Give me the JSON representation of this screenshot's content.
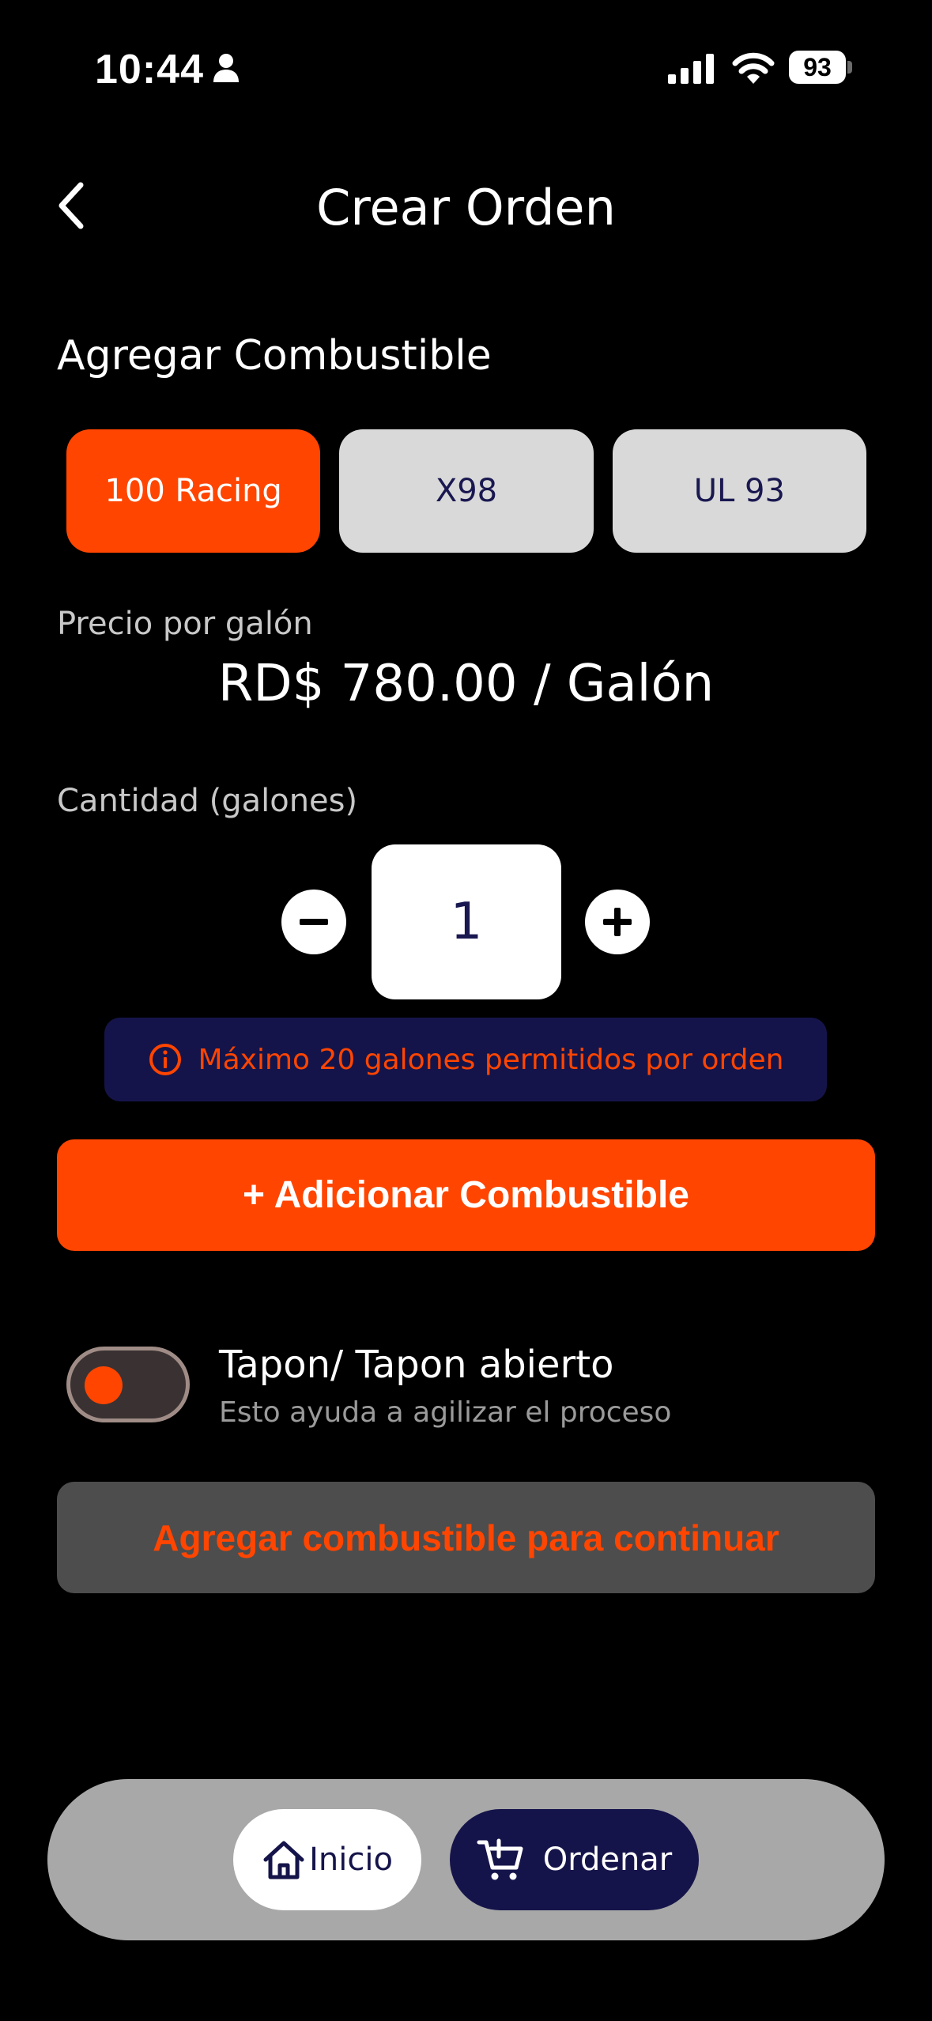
{
  "status_bar": {
    "time": "10:44",
    "battery": "93",
    "icons": [
      "person-icon",
      "signal-icon",
      "wifi-icon",
      "battery-icon"
    ]
  },
  "header": {
    "title": "Crear Orden",
    "back_icon": "chevron-left-icon"
  },
  "fuel": {
    "section_title": "Agregar Combustible",
    "options": [
      {
        "label": "100 Racing",
        "selected": true
      },
      {
        "label": "X98",
        "selected": false
      },
      {
        "label": "UL 93",
        "selected": false
      }
    ]
  },
  "price": {
    "label": "Precio por galón",
    "value": "RD$ 780.00 / Galón"
  },
  "quantity": {
    "label": "Cantidad (galones)",
    "value": "1",
    "minus_icon": "minus-icon",
    "plus_icon": "plus-icon"
  },
  "notice": {
    "text": "Máximo 20 galones permitidos por orden",
    "icon": "info-icon"
  },
  "add_button": {
    "label": "+ Adicionar Combustible"
  },
  "toggle": {
    "title": "Tapon/ Tapon abierto",
    "subtitle": "Esto ayuda a agilizar el proceso",
    "on": false
  },
  "continue_button": {
    "label": "Agregar combustible para continuar"
  },
  "bottom_nav": {
    "home_label": "Inicio",
    "order_label": "Ordenar",
    "home_icon": "home-icon",
    "order_icon": "cart-add-icon"
  },
  "colors": {
    "accent": "#ff4500",
    "navy": "#15144a",
    "background": "#000000"
  }
}
